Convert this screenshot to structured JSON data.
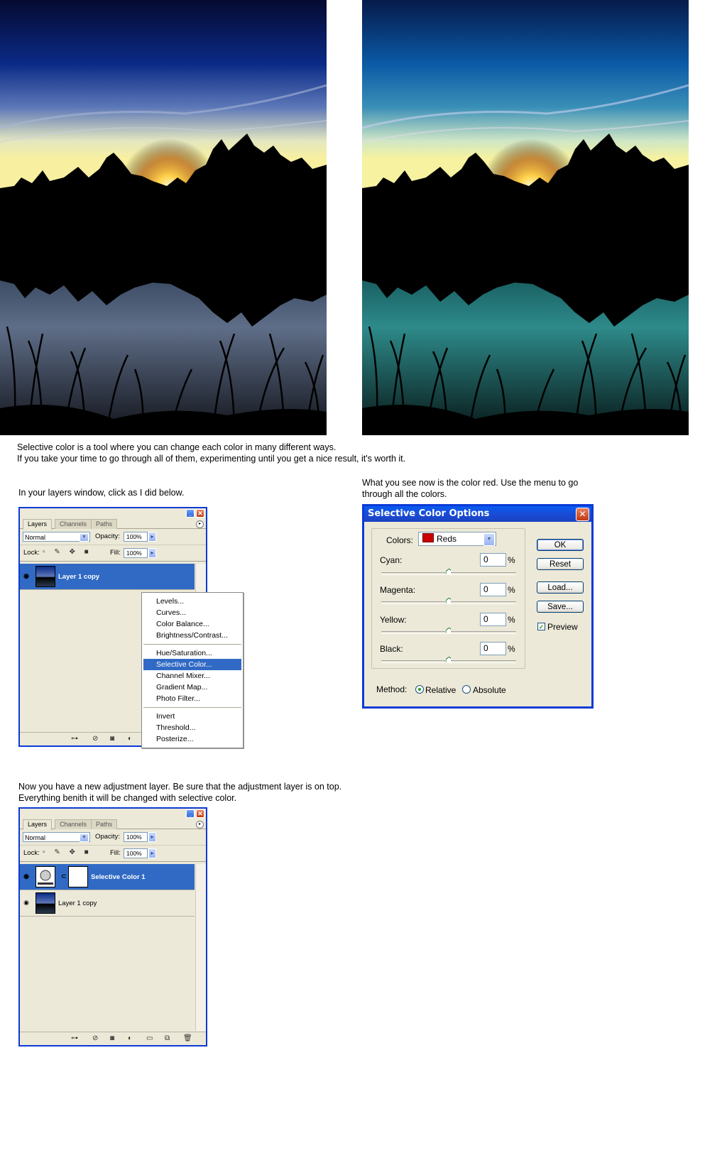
{
  "captions": {
    "intro_line1": "Selective color is a tool where you can change each color in many different ways.",
    "intro_line2": "If you take your time to go through all of them, experimenting until you get a nice result, it's worth it.",
    "layers_instruction": "In your layers window, click as I did below.",
    "color_red_line1": "What you see now is the color red. Use the menu to go",
    "color_red_line2": "through all the colors.",
    "adjustment_line1": "Now you have a new adjustment layer. Be sure that the adjustment layer is on top.",
    "adjustment_line2": "Everything benith it will be changed with selective color."
  },
  "layers_panel_1": {
    "tabs": [
      "Layers",
      "Channels",
      "Paths"
    ],
    "blend_mode": "Normal",
    "opacity_label": "Opacity:",
    "opacity_value": "100%",
    "lock_label": "Lock:",
    "fill_label": "Fill:",
    "fill_value": "100%",
    "layers": [
      {
        "name": "Layer 1 copy",
        "selected": true
      }
    ]
  },
  "adjustment_menu": {
    "group1": [
      "Levels...",
      "Curves...",
      "Color Balance...",
      "Brightness/Contrast..."
    ],
    "group2": [
      "Hue/Saturation...",
      "Selective Color...",
      "Channel Mixer...",
      "Gradient Map...",
      "Photo Filter..."
    ],
    "group3": [
      "Invert",
      "Threshold...",
      "Posterize..."
    ],
    "highlighted": "Selective Color..."
  },
  "layers_panel_2": {
    "tabs": [
      "Layers",
      "Channels",
      "Paths"
    ],
    "blend_mode": "Normal",
    "opacity_label": "Opacity:",
    "opacity_value": "100%",
    "lock_label": "Lock:",
    "fill_label": "Fill:",
    "fill_value": "100%",
    "layers": [
      {
        "name": "Selective Color 1",
        "selected": true
      },
      {
        "name": "Layer 1 copy",
        "selected": false
      }
    ]
  },
  "selective_color_dialog": {
    "title": "Selective Color Options",
    "colors_label": "Colors:",
    "colors_value": "Reds",
    "swatch_color": "#cc0000",
    "sliders": [
      {
        "label": "Cyan:",
        "value": "0",
        "unit": "%"
      },
      {
        "label": "Magenta:",
        "value": "0",
        "unit": "%"
      },
      {
        "label": "Yellow:",
        "value": "0",
        "unit": "%"
      },
      {
        "label": "Black:",
        "value": "0",
        "unit": "%"
      }
    ],
    "buttons": {
      "ok": "OK",
      "reset": "Reset",
      "load": "Load...",
      "save": "Save..."
    },
    "preview_label": "Preview",
    "preview_checked": true,
    "method_label": "Method:",
    "method_options": [
      "Relative",
      "Absolute"
    ],
    "method_selected": "Relative"
  },
  "colors": {
    "xp_blue": "#0b3ad6",
    "selection_blue": "#316ac5",
    "panel_bg": "#ece9d8"
  }
}
